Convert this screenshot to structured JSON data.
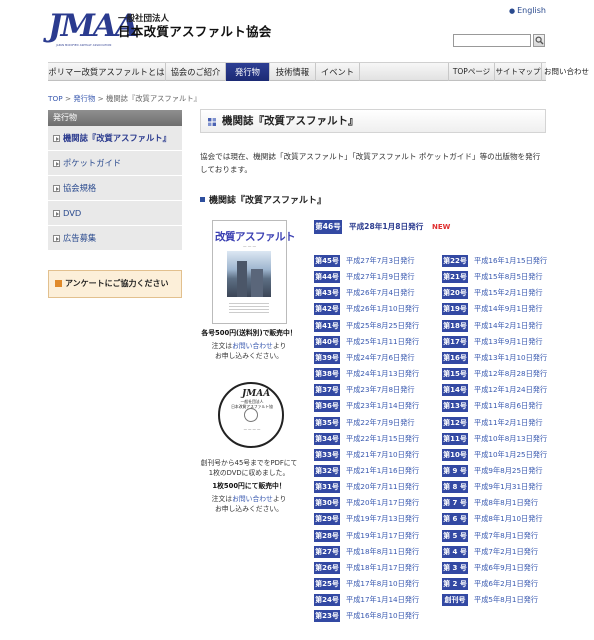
{
  "header": {
    "logo_mark": "JMAA",
    "logo_subtext": "JAPAN MODIFIED ASPHALT ASSOCIATION",
    "org_type": "一般社団法人",
    "org_name": "日本改質アスファルト協会",
    "english_link": "English",
    "search_placeholder": ""
  },
  "nav": {
    "items": [
      "ポリマー改質アスファルトとは",
      "協会のご紹介",
      "発行物",
      "技術情報",
      "イベント"
    ],
    "right_items": [
      "TOPページ",
      "サイトマップ",
      "お問い合わせ"
    ],
    "active": "発行物"
  },
  "breadcrumb": {
    "items": [
      "TOP",
      "発行物",
      "機関誌『改質アスファルト』"
    ],
    "separator": ">"
  },
  "sidebar": {
    "heading": "発行物",
    "items": [
      "機関誌『改質アスファルト』",
      "ポケットガイド",
      "協会規格",
      "DVD",
      "広告募集"
    ],
    "selected_index": 0,
    "survey_button": "アンケートにご協力ください"
  },
  "main": {
    "title": "機関誌『改質アスファルト』",
    "intro": "協会では現在、機関誌「改質アスファルト」「改質アスファルト ポケットガイド」等の出版物を発行しております。",
    "section_heading": "機関誌『改質アスファルト』",
    "cover_title": "改質アスファルト",
    "cover_caption": "各号500円(送料別)で販売中！",
    "order_note_1": "注文は",
    "order_note_link": "お問い合わせ",
    "order_note_2": "より",
    "order_note_3": "お申し込みください。",
    "dvd_logo": "JMAA",
    "dvd_label_1": "一般社団法人",
    "dvd_label_2": "日本改質アスファルト協会",
    "dvd_caption_1": "創刊号から45号までをPDFにて",
    "dvd_caption_2": "1枚のDVDに収めました。",
    "dvd_price": "1枚500円にて販売中！",
    "latest": {
      "no": "第46号",
      "date": "平成28年1月8日発行",
      "badge": "NEW"
    },
    "issues_left": [
      {
        "no": "第45号",
        "date": "平成27年7月3日発行"
      },
      {
        "no": "第44号",
        "date": "平成27年1月9日発行"
      },
      {
        "no": "第43号",
        "date": "平成26年7月4日発行"
      },
      {
        "no": "第42号",
        "date": "平成26年1月10日発行"
      },
      {
        "no": "第41号",
        "date": "平成25年8月25日発行"
      },
      {
        "no": "第40号",
        "date": "平成25年1月11日発行"
      },
      {
        "no": "第39号",
        "date": "平成24年7月6日発行"
      },
      {
        "no": "第38号",
        "date": "平成24年1月13日発行"
      },
      {
        "no": "第37号",
        "date": "平成23年7月8日発行"
      },
      {
        "no": "第36号",
        "date": "平成23年1月14日発行"
      },
      {
        "no": "第35号",
        "date": "平成22年7月9日発行"
      },
      {
        "no": "第34号",
        "date": "平成22年1月15日発行"
      },
      {
        "no": "第33号",
        "date": "平成21年7月10日発行"
      },
      {
        "no": "第32号",
        "date": "平成21年1月16日発行"
      },
      {
        "no": "第31号",
        "date": "平成20年7月11日発行"
      },
      {
        "no": "第30号",
        "date": "平成20年1月17日発行"
      },
      {
        "no": "第29号",
        "date": "平成19年7月13日発行"
      },
      {
        "no": "第28号",
        "date": "平成19年1月17日発行"
      },
      {
        "no": "第27号",
        "date": "平成18年8月11日発行"
      },
      {
        "no": "第26号",
        "date": "平成18年1月17日発行"
      },
      {
        "no": "第25号",
        "date": "平成17年8月10日発行"
      },
      {
        "no": "第24号",
        "date": "平成17年1月14日発行"
      },
      {
        "no": "第23号",
        "date": "平成16年8月10日発行"
      }
    ],
    "issues_right": [
      {
        "no": "第22号",
        "date": "平成16年1月15日発行"
      },
      {
        "no": "第21号",
        "date": "平成15年8月5日発行"
      },
      {
        "no": "第20号",
        "date": "平成15年2月1日発行"
      },
      {
        "no": "第19号",
        "date": "平成14年9月1日発行"
      },
      {
        "no": "第18号",
        "date": "平成14年2月1日発行"
      },
      {
        "no": "第17号",
        "date": "平成13年9月1日発行"
      },
      {
        "no": "第16号",
        "date": "平成13年1月10日発行"
      },
      {
        "no": "第15号",
        "date": "平成12年8月28日発行"
      },
      {
        "no": "第14号",
        "date": "平成12年1月24日発行"
      },
      {
        "no": "第13号",
        "date": "平成11年8月6日発行"
      },
      {
        "no": "第12号",
        "date": "平成11年2月1日発行"
      },
      {
        "no": "第11号",
        "date": "平成10年8月13日発行"
      },
      {
        "no": "第10号",
        "date": "平成10年1月25日発行"
      },
      {
        "no": "第 9 号",
        "date": "平成9年8月25日発行"
      },
      {
        "no": "第 8 号",
        "date": "平成9年1月31日発行"
      },
      {
        "no": "第 7 号",
        "date": "平成8年8月1日発行"
      },
      {
        "no": "第 6 号",
        "date": "平成8年1月10日発行"
      },
      {
        "no": "第 5 号",
        "date": "平成7年8月1日発行"
      },
      {
        "no": "第 4 号",
        "date": "平成7年2月1日発行"
      },
      {
        "no": "第 3 号",
        "date": "平成6年9月1日発行"
      },
      {
        "no": "第 2 号",
        "date": "平成6年2月1日発行"
      },
      {
        "no": "創刊号",
        "date": "平成5年8月1日発行"
      }
    ]
  },
  "colors": {
    "brand_navy": "#2b3b8f",
    "nav_active": "#1c2a74",
    "issue_tag": "#3349a3",
    "link": "#3a5ab0",
    "new_badge": "#e03030"
  }
}
